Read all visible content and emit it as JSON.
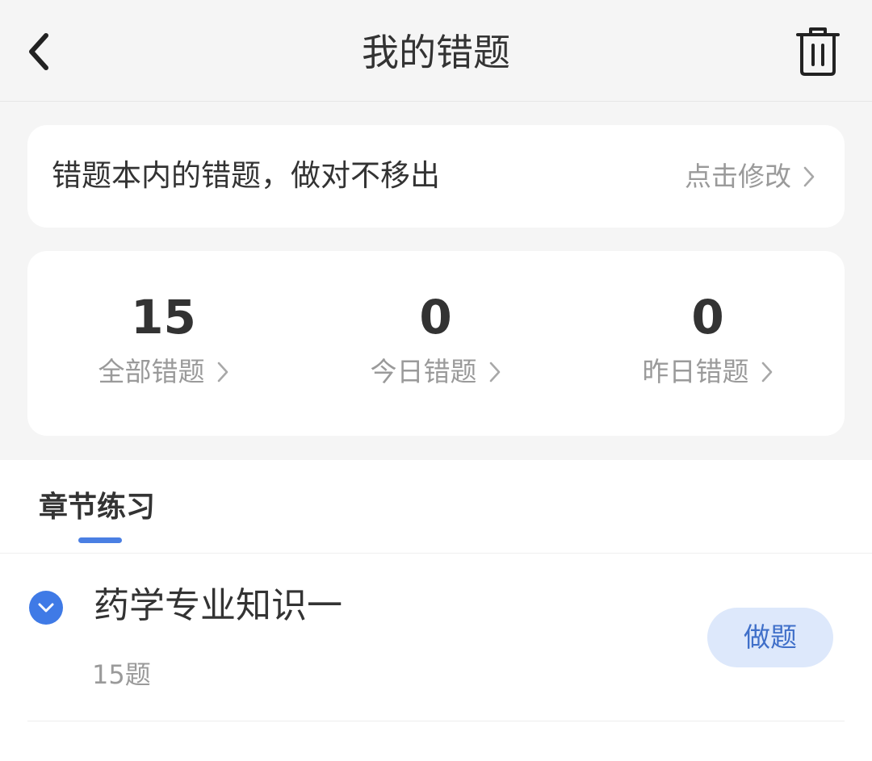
{
  "header": {
    "title": "我的错题",
    "back_icon": "chevron-left-icon",
    "trash_icon": "trash-icon"
  },
  "tip": {
    "text": "错题本内的错题，做对不移出",
    "link_label": "点击修改"
  },
  "stats": [
    {
      "count": "15",
      "label": "全部错题"
    },
    {
      "count": "0",
      "label": "今日错题"
    },
    {
      "count": "0",
      "label": "昨日错题"
    }
  ],
  "tabs": [
    {
      "label": "章节练习",
      "active": true
    }
  ],
  "chapters": [
    {
      "title": "药学专业知识一",
      "count": "15题",
      "button_label": "做题",
      "expanded": true
    }
  ],
  "colors": {
    "accent": "#3f7ae6",
    "button_bg": "#dde8fb",
    "button_text": "#3f6fc9",
    "muted_text": "#9a9a9a",
    "page_bg": "#f5f5f5"
  }
}
